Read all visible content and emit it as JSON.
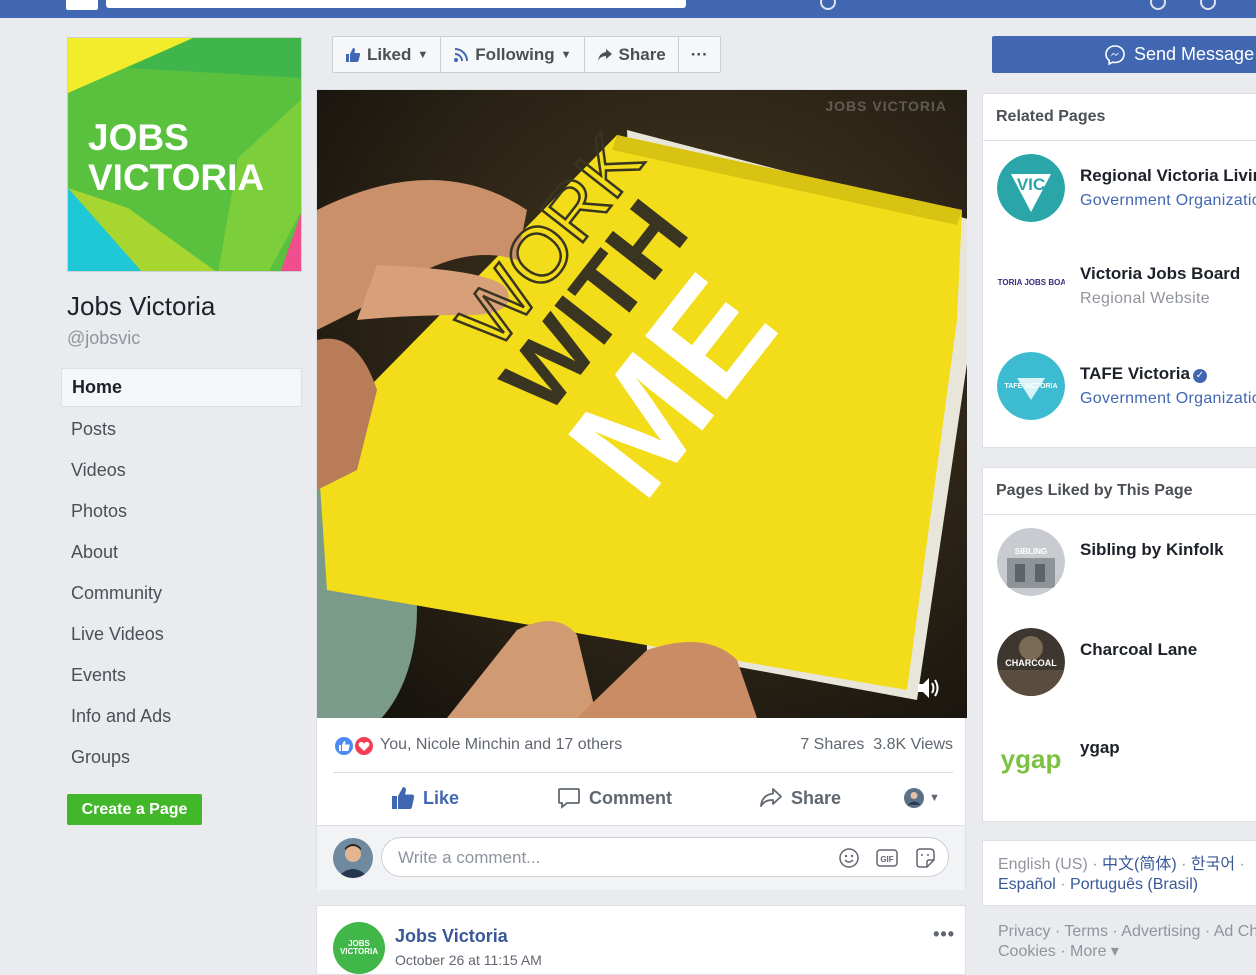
{
  "page": {
    "name": "Jobs Victoria",
    "handle": "@jobsvic",
    "cover_text_line1": "JOBS",
    "cover_text_line2": "VICTORIA"
  },
  "nav": {
    "items": [
      {
        "label": "Home"
      },
      {
        "label": "Posts"
      },
      {
        "label": "Videos"
      },
      {
        "label": "Photos"
      },
      {
        "label": "About"
      },
      {
        "label": "Community"
      },
      {
        "label": "Live Videos"
      },
      {
        "label": "Events"
      },
      {
        "label": "Info and Ads"
      },
      {
        "label": "Groups"
      }
    ],
    "create_page": "Create a Page"
  },
  "action_bar": {
    "liked": "Liked",
    "following": "Following",
    "share": "Share",
    "more": "···",
    "send_message": "Send Message"
  },
  "post": {
    "image_text_line1": "WORK",
    "image_text_line2": "WITH",
    "image_text_line3": "ME",
    "watermark": "JOBS VICTORIA",
    "reactions_names": "You, Nicole Minchin and 17 others",
    "shares": "7 Shares",
    "views": "3.8K Views",
    "like": "Like",
    "comment": "Comment",
    "share": "Share",
    "comment_placeholder": "Write a comment..."
  },
  "next_post": {
    "author": "Jobs Victoria",
    "time": "October 26 at 11:15 AM",
    "avatar_text": "JOBS VICTORIA",
    "more": "•••"
  },
  "related_pages": {
    "title": "Related Pages",
    "items": [
      {
        "name": "Regional Victoria Living",
        "category": "Government Organization",
        "avatar_text": "VIC"
      },
      {
        "name": "Victoria Jobs Board",
        "category": "Regional Website",
        "avatar_text": "VICTORIA JOBS BOARD"
      },
      {
        "name": "TAFE Victoria",
        "category": "Government Organization",
        "avatar_text": "TAFE VICTORIA"
      }
    ]
  },
  "pages_liked": {
    "title": "Pages Liked by This Page",
    "items": [
      {
        "name": "Sibling by Kinfolk",
        "avatar_text": "SIBLING"
      },
      {
        "name": "Charcoal Lane",
        "avatar_text": "CHARCOAL"
      },
      {
        "name": "ygap",
        "avatar_text": "ygap"
      }
    ]
  },
  "languages": {
    "current": "English (US)",
    "links": [
      "中文(简体)",
      "한국어",
      "Español",
      "Português (Brasil)"
    ]
  },
  "footer": {
    "line1": "Privacy · Terms · Advertising · Ad Choices",
    "line2": "Cookies · More ▾"
  },
  "colors": {
    "fb_blue": "#4267b2",
    "jobs_green": "#41b649",
    "create_green": "#42b72a",
    "book_yellow": "#f3dd1a"
  }
}
